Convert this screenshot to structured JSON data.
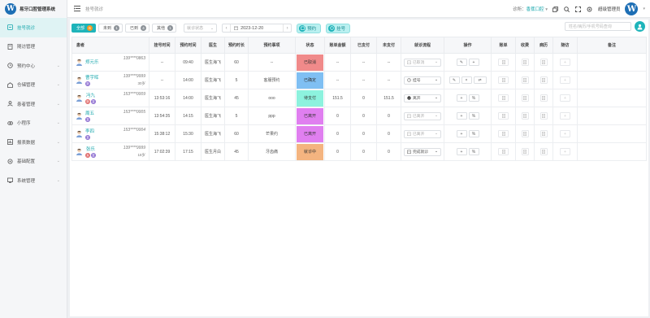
{
  "app": {
    "title": "易牙口腔管理系统"
  },
  "sidebar": {
    "items": [
      {
        "label": "挂号就诊",
        "icon": "registration-icon",
        "active": true,
        "has_children": false
      },
      {
        "label": "随访管理",
        "icon": "followup-icon",
        "active": false,
        "has_children": false
      },
      {
        "label": "预约中心",
        "icon": "appointment-icon",
        "active": false,
        "has_children": true
      },
      {
        "label": "仓储管理",
        "icon": "warehouse-icon",
        "active": false,
        "has_children": true
      },
      {
        "label": "患者管理",
        "icon": "patient-icon",
        "active": false,
        "has_children": true
      },
      {
        "label": "小程序",
        "icon": "miniapp-icon",
        "active": false,
        "has_children": true
      },
      {
        "label": "报表数据",
        "icon": "report-icon",
        "active": false,
        "has_children": true
      },
      {
        "label": "基础配置",
        "icon": "config-icon",
        "active": false,
        "has_children": true
      },
      {
        "label": "系统管理",
        "icon": "system-icon",
        "active": false,
        "has_children": true
      }
    ]
  },
  "topbar": {
    "breadcrumb": "挂号就诊",
    "clinic_label": "诊所：",
    "clinic_name": "香蕉口腔",
    "admin_name": "超级管理员"
  },
  "toolbar": {
    "tabs": [
      {
        "label": "全部",
        "count": "6",
        "active": true
      },
      {
        "label": "未到",
        "count": "1",
        "active": false
      },
      {
        "label": "已到",
        "count": "4",
        "active": false
      },
      {
        "label": "其他",
        "count": "1",
        "active": false
      }
    ],
    "status_placeholder": "就诊状态",
    "date": "2023-12-20",
    "appointment_button": "预约",
    "register_button": "挂号",
    "search_placeholder": "姓名/病历/手机号码查询"
  },
  "table": {
    "headers": [
      "患者",
      "挂号时间",
      "预约时间",
      "医生",
      "预约时长",
      "预约事项",
      "状态",
      "账单金额",
      "已支付",
      "未支付",
      "就诊流程",
      "操作",
      "账单",
      "收费",
      "病历",
      "随访",
      "备注"
    ],
    "rows": [
      {
        "name": "郑元乐",
        "phone": "139****0863",
        "extra": "",
        "tags": [],
        "reg_time": "--",
        "appt_time": "09:40",
        "doctor": "医生海飞",
        "duration": "60",
        "matter": "--",
        "status": "已取消",
        "status_color": "#f08a8a",
        "bill": "--",
        "paid": "--",
        "unpaid": "--",
        "flow": "已取消",
        "flow_icon": "clipboard-icon",
        "flow_dim": true,
        "ops": [
          "edit",
          "add"
        ]
      },
      {
        "name": "曹宇晖",
        "phone": "139****9999",
        "extra": "30岁",
        "tags": [
          {
            "t": "新",
            "c": "#8e6fd1"
          }
        ],
        "reg_time": "--",
        "appt_time": "14:00",
        "doctor": "医生海飞",
        "duration": "5",
        "matter": "客服预约",
        "status": "已确定",
        "status_color": "#7fbff3",
        "bill": "--",
        "paid": "--",
        "unpaid": "--",
        "flow": "挂号",
        "flow_icon": "clock-icon",
        "flow_dim": false,
        "ops": [
          "edit",
          "cancel",
          "swap"
        ]
      },
      {
        "name": "冯九",
        "phone": "153****0009",
        "extra": "",
        "tags": [
          {
            "t": "新",
            "c": "#e06c6c"
          },
          {
            "t": "复",
            "c": "#8e6fd1"
          }
        ],
        "reg_time": "13:53:16",
        "appt_time": "14:00",
        "doctor": "医生海飞",
        "duration": "45",
        "matter": "ooo",
        "status": "待支付",
        "status_color": "#8df2de",
        "bill": "151.5",
        "paid": "0",
        "unpaid": "151.5",
        "flow": "离开",
        "flow_icon": "check-icon",
        "flow_dim": false,
        "ops": [
          "add",
          "pay"
        ]
      },
      {
        "name": "周五",
        "phone": "153****0005",
        "extra": "",
        "tags": [
          {
            "t": "复",
            "c": "#8e6fd1"
          }
        ],
        "reg_time": "13:54:35",
        "appt_time": "14:15",
        "doctor": "医生海飞",
        "duration": "5",
        "matter": "ppp",
        "status": "已离开",
        "status_color": "#e07ff0",
        "bill": "0",
        "paid": "0",
        "unpaid": "0",
        "flow": "已离开",
        "flow_icon": "clipboard-icon",
        "flow_dim": true,
        "ops": [
          "add",
          "pay"
        ]
      },
      {
        "name": "李四",
        "phone": "153****0004",
        "extra": "",
        "tags": [
          {
            "t": "复",
            "c": "#8e6fd1"
          }
        ],
        "reg_time": "15:38:12",
        "appt_time": "15:30",
        "doctor": "医生海飞",
        "duration": "60",
        "matter": "芒果约",
        "status": "已离开",
        "status_color": "#e07ff0",
        "bill": "0",
        "paid": "0",
        "unpaid": "0",
        "flow": "已离开",
        "flow_icon": "clipboard-icon",
        "flow_dim": true,
        "ops": [
          "add",
          "pay"
        ]
      },
      {
        "name": "张乐",
        "phone": "139****9999",
        "extra": "18岁",
        "tags": [
          {
            "t": "女",
            "c": "#e06c6c"
          },
          {
            "t": "复",
            "c": "#8e6fd1"
          }
        ],
        "reg_time": "17:02:39",
        "appt_time": "17:15",
        "doctor": "医生月白",
        "duration": "45",
        "matter": "牙齿痛",
        "status": "就诊中",
        "status_color": "#f4b480",
        "bill": "0",
        "paid": "0",
        "unpaid": "0",
        "flow": "完成就诊",
        "flow_icon": "clipboard-icon",
        "flow_dim": false,
        "ops": [
          "add",
          "pay"
        ]
      }
    ]
  },
  "colors": {
    "accent": "#1fb4ba",
    "brand": "#1e6fb5"
  }
}
